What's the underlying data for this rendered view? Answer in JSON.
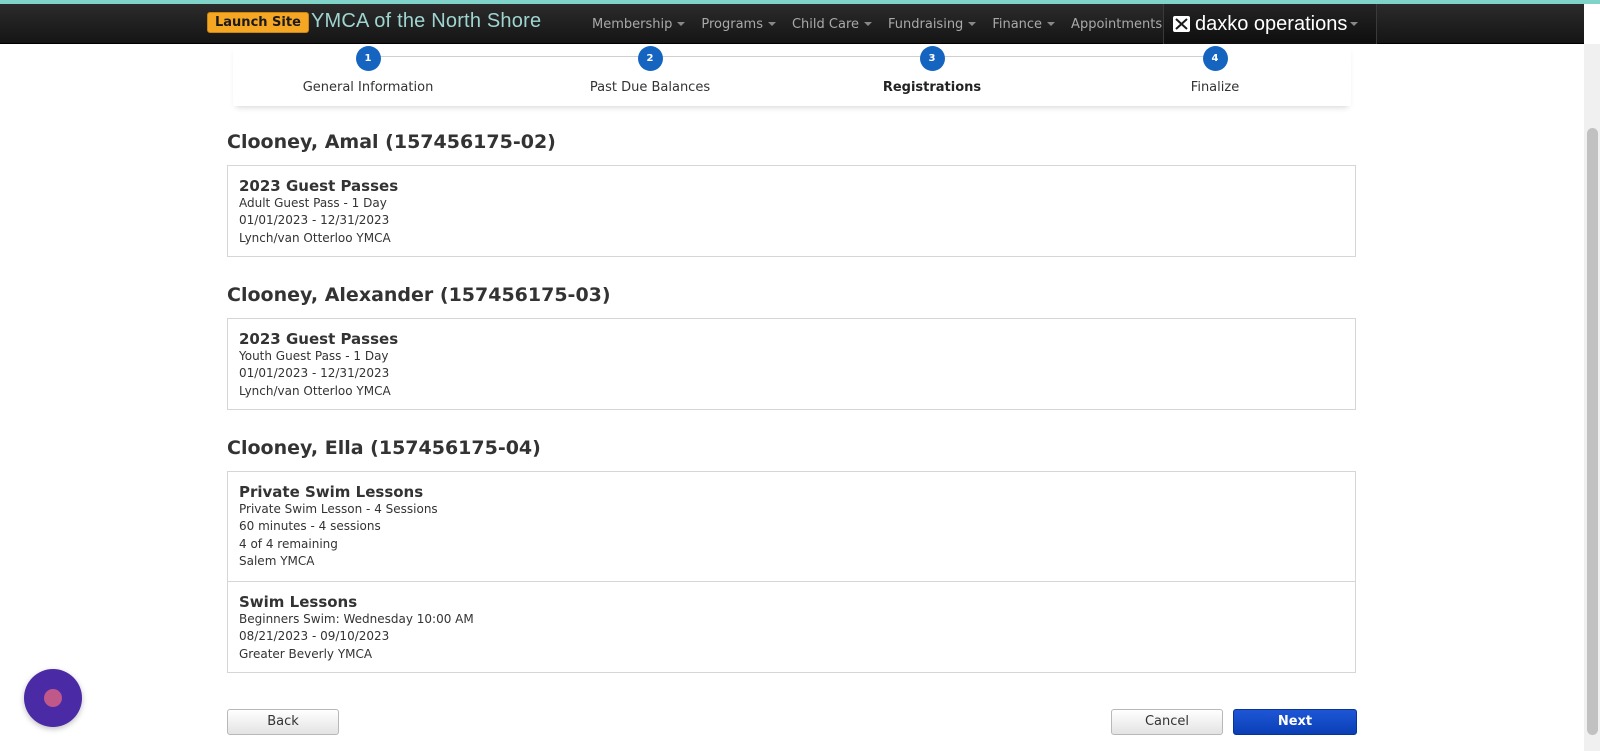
{
  "navbar": {
    "launch_label": "Launch Site",
    "brand": "YMCA of the North Shore",
    "menu": [
      "Membership",
      "Programs",
      "Child Care",
      "Fundraising",
      "Finance",
      "Appointments"
    ],
    "product": "daxko operations",
    "colors": {
      "bar": "#1e1e1e",
      "launch": "#f5a623",
      "brand": "#9fd5d0"
    }
  },
  "steps": [
    {
      "number": "1",
      "label": "General Information",
      "active": false
    },
    {
      "number": "2",
      "label": "Past Due Balances",
      "active": false
    },
    {
      "number": "3",
      "label": "Registrations",
      "active": true
    },
    {
      "number": "4",
      "label": "Finalize",
      "active": false
    }
  ],
  "people": [
    {
      "name": "Clooney, Amal (157456175-02)",
      "registrations": [
        {
          "title": "2023 Guest Passes",
          "lines": [
            "Adult Guest Pass - 1 Day",
            "01/01/2023 - 12/31/2023",
            "Lynch/van Otterloo YMCA"
          ]
        }
      ]
    },
    {
      "name": "Clooney, Alexander (157456175-03)",
      "registrations": [
        {
          "title": "2023 Guest Passes",
          "lines": [
            "Youth Guest Pass - 1 Day",
            "01/01/2023 - 12/31/2023",
            "Lynch/van Otterloo YMCA"
          ]
        }
      ]
    },
    {
      "name": "Clooney, Ella (157456175-04)",
      "registrations": [
        {
          "title": "Private Swim Lessons",
          "lines": [
            "Private Swim Lesson - 4 Sessions",
            "60 minutes - 4 sessions",
            "4 of 4 remaining",
            "Salem YMCA"
          ]
        },
        {
          "title": "Swim Lessons",
          "lines": [
            "Beginners Swim: Wednesday 10:00 AM",
            "08/21/2023 - 09/10/2023",
            "Greater Beverly YMCA"
          ]
        }
      ]
    }
  ],
  "buttons": {
    "back": "Back",
    "cancel": "Cancel",
    "next": "Next"
  },
  "icons": {
    "product_logo": "envelope-icon",
    "chat": "chat-widget-icon"
  }
}
